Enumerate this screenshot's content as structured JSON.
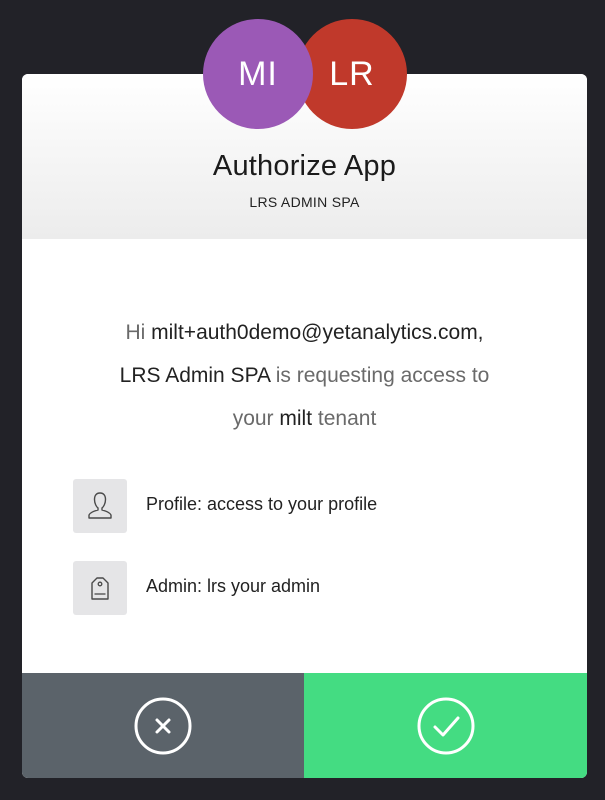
{
  "dialog": {
    "title": "Authorize App",
    "subtitle": "LRS ADMIN SPA",
    "user_avatar": {
      "initials": "MI",
      "color": "#9b59b6"
    },
    "app_avatar": {
      "initials": "LR",
      "color": "#c0392b"
    }
  },
  "message": {
    "greeting": "Hi",
    "email": "milt+auth0demo@yetanalytics.com,",
    "app_name": "LRS Admin SPA",
    "requesting": "is requesting access to",
    "your": "your",
    "tenant_name": "milt",
    "tenant_word": "tenant"
  },
  "scopes": [
    {
      "icon": "user-icon",
      "text": "Profile: access to your profile"
    },
    {
      "icon": "tag-icon",
      "text": "Admin: lrs your admin"
    }
  ],
  "actions": {
    "deny": {
      "icon": "close-circle-icon",
      "color": "#5b636a"
    },
    "allow": {
      "icon": "check-circle-icon",
      "color": "#44dc82"
    }
  }
}
